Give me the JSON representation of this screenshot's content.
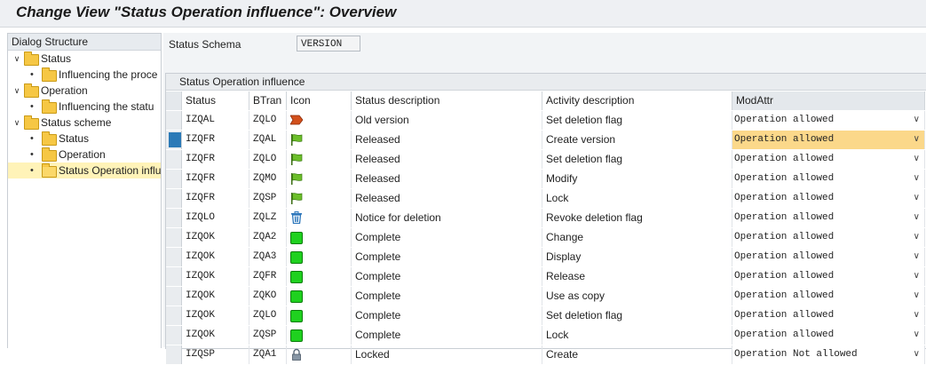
{
  "window": {
    "title": "Change View \"Status Operation influence\": Overview"
  },
  "tree": {
    "header": "Dialog Structure",
    "nodes": [
      {
        "label": "Status",
        "level": 0,
        "expanded": true,
        "selected": false
      },
      {
        "label": "Influencing the proce",
        "level": 1,
        "expanded": false,
        "selected": false
      },
      {
        "label": "Operation",
        "level": 0,
        "expanded": true,
        "selected": false
      },
      {
        "label": "Influencing the statu",
        "level": 1,
        "expanded": false,
        "selected": false
      },
      {
        "label": "Status scheme",
        "level": 0,
        "expanded": true,
        "selected": false
      },
      {
        "label": "Status",
        "level": 1,
        "expanded": false,
        "selected": false
      },
      {
        "label": "Operation",
        "level": 1,
        "expanded": false,
        "selected": false
      },
      {
        "label": "Status Operation influ",
        "level": 1,
        "expanded": false,
        "selected": true
      }
    ]
  },
  "schema": {
    "label": "Status Schema",
    "value": "VERSION"
  },
  "table": {
    "title": "Status Operation influence",
    "headers": {
      "status": "Status",
      "btran": "BTran",
      "icon": "Icon",
      "sdesc": "Status description",
      "adesc": "Activity description",
      "mod": "ModAttr"
    },
    "rows": [
      {
        "status": "IZQAL",
        "btran": "ZQLO",
        "icon": "red-flag-icon",
        "sdesc": "Old version",
        "adesc": "Set deletion flag",
        "mod": "Operation allowed",
        "highlight": false
      },
      {
        "status": "IZQFR",
        "btran": "ZQAL",
        "icon": "green-flag-icon",
        "sdesc": "Released",
        "adesc": "Create version",
        "mod": "Operation allowed",
        "highlight": true
      },
      {
        "status": "IZQFR",
        "btran": "ZQLO",
        "icon": "green-flag-icon",
        "sdesc": "Released",
        "adesc": "Set deletion flag",
        "mod": "Operation allowed",
        "highlight": false
      },
      {
        "status": "IZQFR",
        "btran": "ZQMO",
        "icon": "green-flag-icon",
        "sdesc": "Released",
        "adesc": "Modify",
        "mod": "Operation allowed",
        "highlight": false
      },
      {
        "status": "IZQFR",
        "btran": "ZQSP",
        "icon": "green-flag-icon",
        "sdesc": "Released",
        "adesc": "Lock",
        "mod": "Operation allowed",
        "highlight": false
      },
      {
        "status": "IZQLO",
        "btran": "ZQLZ",
        "icon": "trash-icon",
        "sdesc": "Notice for deletion",
        "adesc": "Revoke deletion flag",
        "mod": "Operation allowed",
        "highlight": false
      },
      {
        "status": "IZQOK",
        "btran": "ZQA2",
        "icon": "green-square-icon",
        "sdesc": "Complete",
        "adesc": "Change",
        "mod": "Operation allowed",
        "highlight": false
      },
      {
        "status": "IZQOK",
        "btran": "ZQA3",
        "icon": "green-square-icon",
        "sdesc": "Complete",
        "adesc": "Display",
        "mod": "Operation allowed",
        "highlight": false
      },
      {
        "status": "IZQOK",
        "btran": "ZQFR",
        "icon": "green-square-icon",
        "sdesc": "Complete",
        "adesc": "Release",
        "mod": "Operation allowed",
        "highlight": false
      },
      {
        "status": "IZQOK",
        "btran": "ZQKO",
        "icon": "green-square-icon",
        "sdesc": "Complete",
        "adesc": "Use as copy",
        "mod": "Operation allowed",
        "highlight": false
      },
      {
        "status": "IZQOK",
        "btran": "ZQLO",
        "icon": "green-square-icon",
        "sdesc": "Complete",
        "adesc": "Set deletion flag",
        "mod": "Operation allowed",
        "highlight": false
      },
      {
        "status": "IZQOK",
        "btran": "ZQSP",
        "icon": "green-square-icon",
        "sdesc": "Complete",
        "adesc": "Lock",
        "mod": "Operation allowed",
        "highlight": false
      },
      {
        "status": "IZQSP",
        "btran": "ZQA1",
        "icon": "lock-icon",
        "sdesc": "Locked",
        "adesc": "Create",
        "mod": "Operation Not allowed",
        "highlight": false
      }
    ]
  },
  "colors": {
    "selection_marker": "#2c7ab7",
    "row_highlight": "#d2e8f5",
    "cell_focus": "#fbd88a",
    "folder": "#f6c744"
  }
}
